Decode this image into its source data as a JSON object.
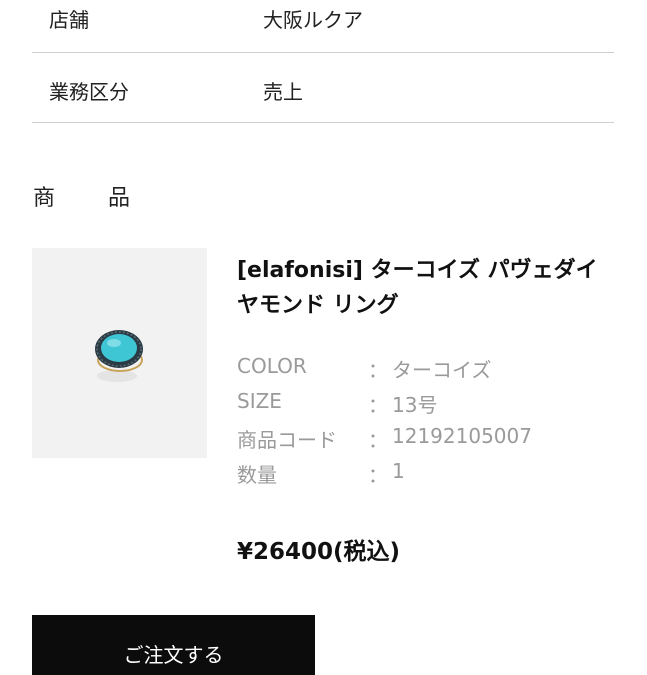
{
  "order_info": {
    "rows": [
      {
        "label": "店舗",
        "value": "大阪ルクア"
      },
      {
        "label": "業務区分",
        "value": "売上"
      }
    ]
  },
  "product_section": {
    "title_char_1": "商",
    "title_char_2": "品",
    "product": {
      "name": "[elafonisi] ターコイズ パヴェダイヤモンド リング",
      "image_icon": "turquoise-ring-image",
      "specs": [
        {
          "key": "COLOR",
          "sep": "：",
          "value": "ターコイズ"
        },
        {
          "key": "SIZE",
          "sep": "：",
          "value": "13号"
        },
        {
          "key": "商品コード",
          "sep": "：",
          "value": "12192105007"
        },
        {
          "key": "数量",
          "sep": "：",
          "value": "1"
        }
      ],
      "price": "¥26400(税込)"
    }
  },
  "actions": {
    "order_button_label": "ご注文する"
  },
  "colors": {
    "background": "#ffffff",
    "divider": "#cfcfcf",
    "spec_text": "#9a9a9a",
    "button_bg": "#0c0c0c",
    "turquoise": "#3fc6d4"
  }
}
